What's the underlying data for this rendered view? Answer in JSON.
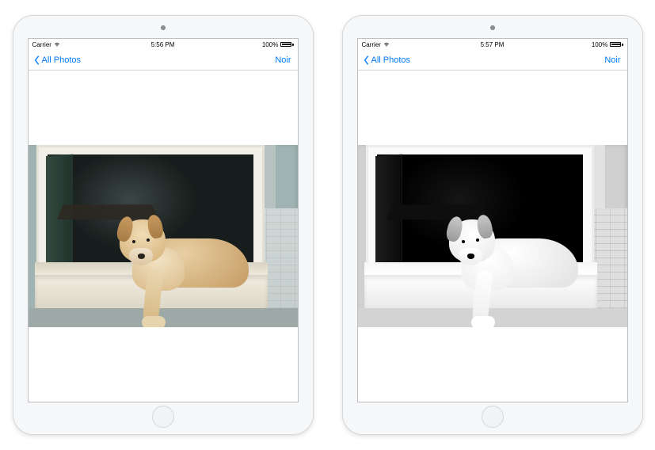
{
  "devices": [
    {
      "status": {
        "carrier": "Carrier",
        "time": "5:56 PM",
        "battery_pct": "100%"
      },
      "nav": {
        "back_label": "All Photos",
        "right_label": "Noir"
      },
      "photo": {
        "variant": "color",
        "subject": "golden-retriever-on-doorway-step"
      }
    },
    {
      "status": {
        "carrier": "Carrier",
        "time": "5:57 PM",
        "battery_pct": "100%"
      },
      "nav": {
        "back_label": "All Photos",
        "right_label": "Noir"
      },
      "photo": {
        "variant": "noir",
        "subject": "golden-retriever-on-doorway-step"
      }
    }
  ],
  "colors": {
    "ios_tint": "#007aff"
  }
}
